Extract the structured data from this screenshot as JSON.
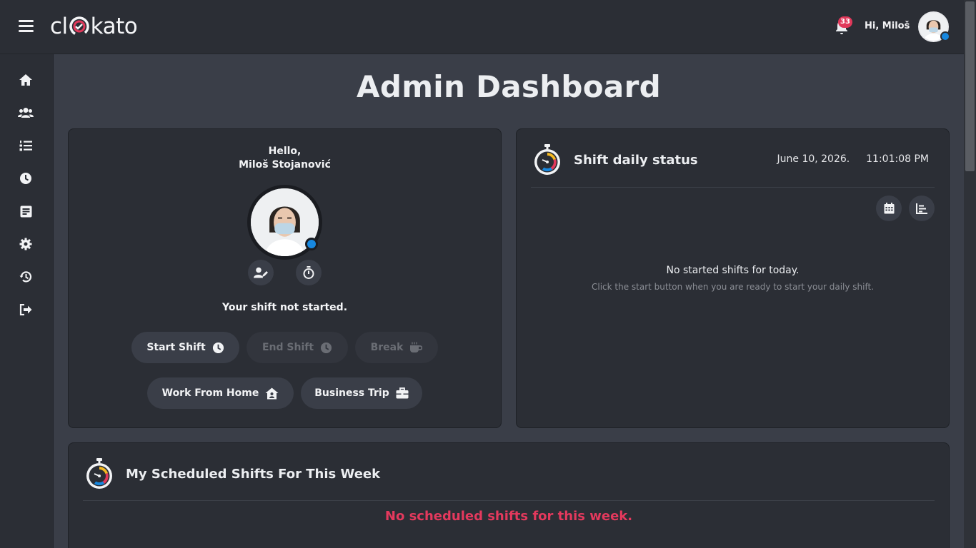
{
  "app": {
    "logo_text_left": "cl",
    "logo_text_right": "kato"
  },
  "header": {
    "greeting": "Hi, Miloš",
    "notification_count": "33",
    "status_color": "#1788e0"
  },
  "sidebar": {
    "items": [
      {
        "name": "home",
        "icon": "home-icon"
      },
      {
        "name": "users",
        "icon": "users-icon"
      },
      {
        "name": "list",
        "icon": "ordered-list-icon"
      },
      {
        "name": "clock",
        "icon": "clock-icon"
      },
      {
        "name": "reports",
        "icon": "document-icon"
      },
      {
        "name": "settings",
        "icon": "gear-icon"
      },
      {
        "name": "history",
        "icon": "history-icon"
      },
      {
        "name": "logout",
        "icon": "logout-icon"
      }
    ]
  },
  "page": {
    "title": "Admin Dashboard"
  },
  "profile_card": {
    "hello_line1": "Hello,",
    "hello_line2": "Miloš Stojanović",
    "shift_status": "Your shift not started.",
    "buttons": {
      "start_shift": "Start Shift",
      "end_shift": "End Shift",
      "break": "Break",
      "work_from_home": "Work From Home",
      "business_trip": "Business Trip"
    }
  },
  "daily_status": {
    "title": "Shift daily status",
    "date": "June 10, 2026.",
    "time": "11:01:08 PM",
    "empty_title": "No started shifts for today.",
    "empty_subtitle": "Click the start button when you are ready to start your daily shift."
  },
  "scheduled": {
    "title": "My Scheduled Shifts For This Week",
    "empty": "No scheduled shifts for this week."
  },
  "colors": {
    "accent_red": "#e4395d",
    "badge_red": "#e0385a",
    "online_blue": "#1788e0",
    "card_bg": "#2b2e35",
    "page_bg": "#3a3e48"
  }
}
